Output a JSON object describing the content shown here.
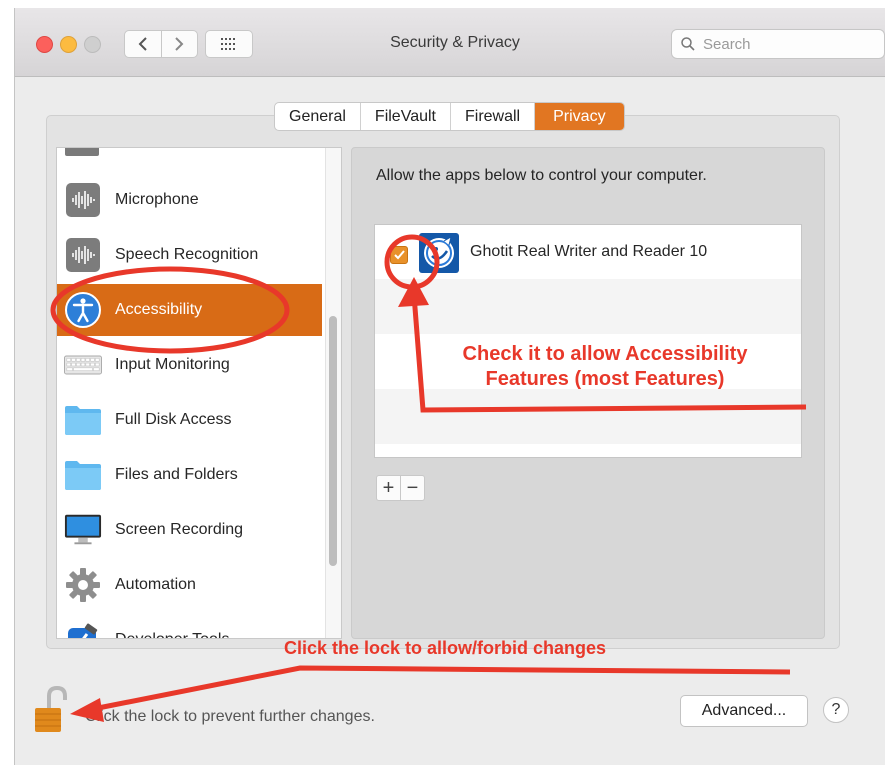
{
  "window": {
    "title": "Security & Privacy"
  },
  "search": {
    "placeholder": "Search"
  },
  "tabs": [
    {
      "label": "General",
      "active": false
    },
    {
      "label": "FileVault",
      "active": false
    },
    {
      "label": "Firewall",
      "active": false
    },
    {
      "label": "Privacy",
      "active": true
    }
  ],
  "sidebar": {
    "items": [
      {
        "label": "Microphone",
        "icon": "microphone-icon"
      },
      {
        "label": "Speech Recognition",
        "icon": "speech-recognition-icon"
      },
      {
        "label": "Accessibility",
        "icon": "accessibility-icon",
        "selected": true
      },
      {
        "label": "Input Monitoring",
        "icon": "keyboard-icon"
      },
      {
        "label": "Full Disk Access",
        "icon": "folder-icon"
      },
      {
        "label": "Files and Folders",
        "icon": "folder-icon"
      },
      {
        "label": "Screen Recording",
        "icon": "display-icon"
      },
      {
        "label": "Automation",
        "icon": "gear-icon"
      },
      {
        "label": "Developer Tools",
        "icon": "developer-tools-icon"
      }
    ]
  },
  "main": {
    "description": "Allow the apps below to control your computer.",
    "apps": [
      {
        "name": "Ghotit Real Writer and Reader 10",
        "checked": true,
        "icon": "ghotit-app-icon"
      }
    ],
    "add_label": "+",
    "remove_label": "−"
  },
  "footer": {
    "lock_text": "Click the lock to prevent further changes.",
    "advanced_label": "Advanced...",
    "help_label": "?"
  },
  "annotations": {
    "check_note_line1": "Check it to allow Accessibility",
    "check_note_line2": "Features (most Features)",
    "lock_note": "Click the lock to allow/forbid changes"
  },
  "colors": {
    "accent": "#e17622",
    "selection": "#d86b16",
    "annotation": "#e8382a"
  }
}
